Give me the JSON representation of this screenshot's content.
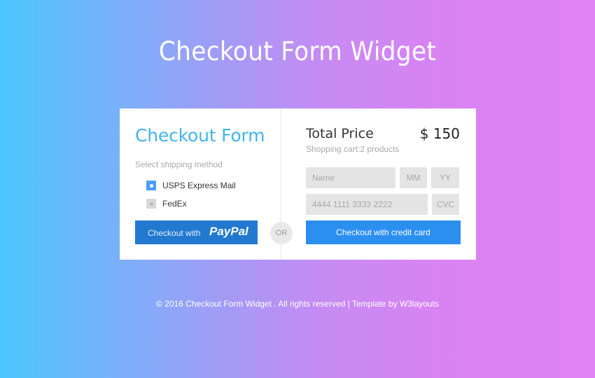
{
  "header": {
    "title": "Checkout Form Widget"
  },
  "checkout_form": {
    "title": "Checkout Form",
    "shipping_label": "Select shipping method",
    "shipping_options": [
      {
        "label": "USPS Express Mail",
        "selected": true
      },
      {
        "label": "FedEx",
        "selected": false
      }
    ],
    "paypal_button": {
      "prefix": "Checkout with",
      "brand": "PayPal"
    },
    "or_label": "OR"
  },
  "payment": {
    "total_label": "Total Price",
    "total_value": "$ 150",
    "cart_info": "Shopping cart:2 products",
    "name_placeholder": "Name",
    "mm_placeholder": "MM",
    "yy_placeholder": "YY",
    "card_placeholder": "4444 1111 3333 2222",
    "cvc_placeholder": "CVC",
    "submit_label": "Checkout with credit card"
  },
  "footer": {
    "text": "© 2016 Checkout Form Widget . All rights reserved | Template by W3layouts"
  },
  "colors": {
    "accent_title": "#41b4ec",
    "paypal_button": "#2179d0",
    "credit_button": "#2b8ff0",
    "radio_checked": "#4b9ef5"
  }
}
